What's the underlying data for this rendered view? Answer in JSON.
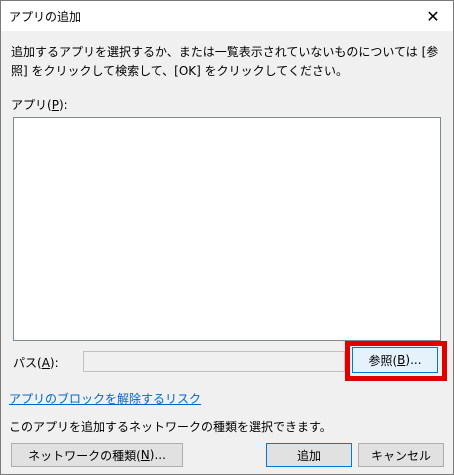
{
  "window": {
    "title": "アプリの追加",
    "close_glyph": "✕"
  },
  "description": "追加するアプリを選択するか、または一覧表示されていないものについては [参照] をクリックして検索して、[OK] をクリックしてください。",
  "apps": {
    "label_prefix": "アプリ(",
    "label_key": "P",
    "label_suffix": "):",
    "items": []
  },
  "path": {
    "label_prefix": "パス(",
    "label_key": "A",
    "label_suffix": "):",
    "value": ""
  },
  "buttons": {
    "browse": {
      "prefix": "参照(",
      "key": "B",
      "suffix": ")..."
    },
    "network": {
      "prefix": "ネットワークの種類(",
      "key": "N",
      "suffix": ")..."
    },
    "add": "追加",
    "cancel": "キャンセル"
  },
  "risk_link": "アプリのブロックを解除するリスク",
  "network_info": "このアプリを追加するネットワークの種類を選択できます。",
  "colors": {
    "highlight": "#e00000",
    "link": "#0066cc",
    "default_button_border": "#0078d7"
  }
}
